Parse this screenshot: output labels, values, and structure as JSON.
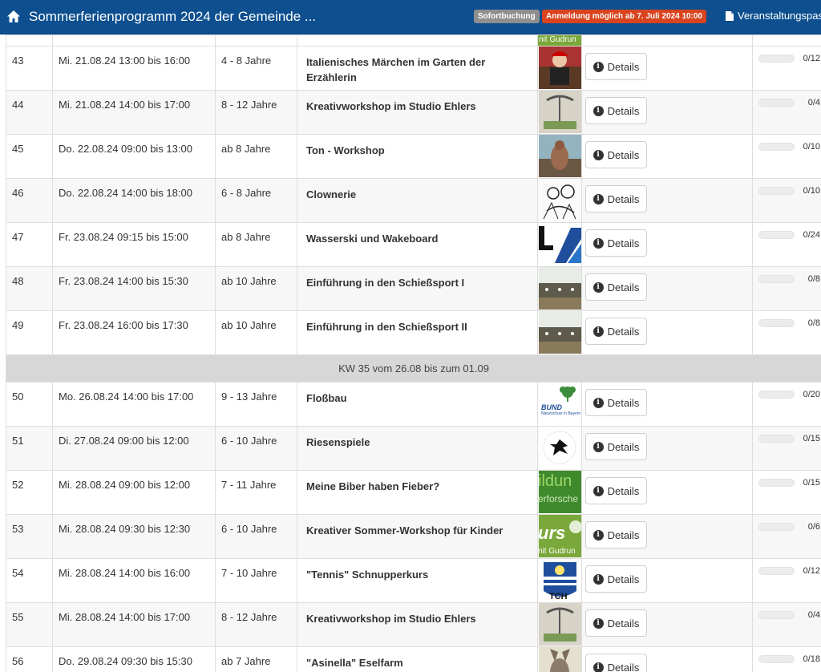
{
  "header": {
    "title": "Sommerferienprogramm 2024 der Gemeinde ...",
    "badge_instant": "Sofortbuchung",
    "badge_registration": "Anmeldung möglich ab 7. Juli 2024 10:00",
    "doc_link": "Veranstaltungspas",
    "colors": {
      "bar": "#0d4f8f",
      "badge_grey": "#8e8e8e",
      "badge_red": "#d9441f"
    }
  },
  "partial_top": {
    "image_text": "nit Gudrun"
  },
  "details_label": "Details",
  "rows_a": [
    {
      "nr": "43",
      "date": "Mi. 21.08.24 13:00 bis 16:00",
      "age": "4 - 8 Jahre",
      "title": "Italienisches Märchen im Garten der Erzählerin",
      "capacity": "0/12",
      "fill": 0,
      "image": "storyteller-photo"
    },
    {
      "nr": "44",
      "date": "Mi. 21.08.24 14:00 bis 17:00",
      "age": "8 - 12 Jahre",
      "title": "Kreativworkshop im Studio Ehlers",
      "capacity": "0/4",
      "fill": 0,
      "image": "studio-photo"
    },
    {
      "nr": "45",
      "date": "Do. 22.08.24 09:00 bis 13:00",
      "age": "ab 8 Jahre",
      "title": "Ton - Workshop",
      "capacity": "0/10",
      "fill": 0,
      "image": "clay-sculpture-photo"
    },
    {
      "nr": "46",
      "date": "Do. 22.08.24 14:00 bis 18:00",
      "age": "6 - 8 Jahre",
      "title": "Clownerie",
      "capacity": "0/10",
      "fill": 0,
      "image": "clown-drawing"
    },
    {
      "nr": "47",
      "date": "Fr. 23.08.24 09:15 bis 15:00",
      "age": "ab 8 Jahre",
      "title": "Wasserski und Wakeboard",
      "capacity": "0/24",
      "fill": 0,
      "image": "wakeboard-logo"
    },
    {
      "nr": "48",
      "date": "Fr. 23.08.24 14:00 bis 15:30",
      "age": "ab 10 Jahre",
      "title": "Einführung in den Schießsport I",
      "capacity": "0/8",
      "fill": 0,
      "image": "shooting-range-photo"
    },
    {
      "nr": "49",
      "date": "Fr. 23.08.24 16:00 bis 17:30",
      "age": "ab 10 Jahre",
      "title": "Einführung in den Schießsport II",
      "capacity": "0/8",
      "fill": 0,
      "image": "shooting-range-photo"
    }
  ],
  "week_header": "KW 35 vom 26.08 bis zum 01.09",
  "rows_b": [
    {
      "nr": "50",
      "date": "Mo. 26.08.24 14:00 bis 17:00",
      "age": "9 - 13 Jahre",
      "title": "Floßbau",
      "capacity": "0/20",
      "fill": 0,
      "image": "bund-logo",
      "image_text": "BUND",
      "image_text2": "Naturschutz in Bayern e.V."
    },
    {
      "nr": "51",
      "date": "Di. 27.08.24 09:00 bis 12:00",
      "age": "6 - 10 Jahre",
      "title": "Riesenspiele",
      "capacity": "0/15",
      "fill": 0,
      "image": "leaf-logo"
    },
    {
      "nr": "52",
      "date": "Mi. 28.08.24 09:00 bis 12:00",
      "age": "7 - 11 Jahre",
      "title": "Meine Biber haben Fieber?",
      "capacity": "0/15",
      "fill": 0,
      "image": "green-banner",
      "image_text": "ildun",
      "image_text2": "erforsche"
    },
    {
      "nr": "53",
      "date": "Mi. 28.08.24 09:30 bis 12:30",
      "age": "6 - 10 Jahre",
      "title": "Kreativer Sommer-Workshop für Kinder",
      "capacity": "0/6",
      "fill": 0,
      "image": "kurs-banner",
      "image_text": "urs",
      "image_text2": "nit Gudrun"
    },
    {
      "nr": "54",
      "date": "Mi. 28.08.24 14:00 bis 16:00",
      "age": "7 - 10 Jahre",
      "title": "\"Tennis\" Schnupperkurs",
      "capacity": "0/12",
      "fill": 0,
      "image": "tch-logo",
      "image_text": "TCH"
    },
    {
      "nr": "55",
      "date": "Mi. 28.08.24 14:00 bis 17:00",
      "age": "8 - 12 Jahre",
      "title": "Kreativworkshop im Studio Ehlers",
      "capacity": "0/4",
      "fill": 0,
      "image": "studio-photo"
    },
    {
      "nr": "56",
      "date": "Do. 29.08.24 09:30 bis 15:30",
      "age": "ab 7 Jahre",
      "title": "\"Asinella\" Eselfarm",
      "capacity": "0/18",
      "fill": 0,
      "image": "donkey-photo"
    }
  ]
}
